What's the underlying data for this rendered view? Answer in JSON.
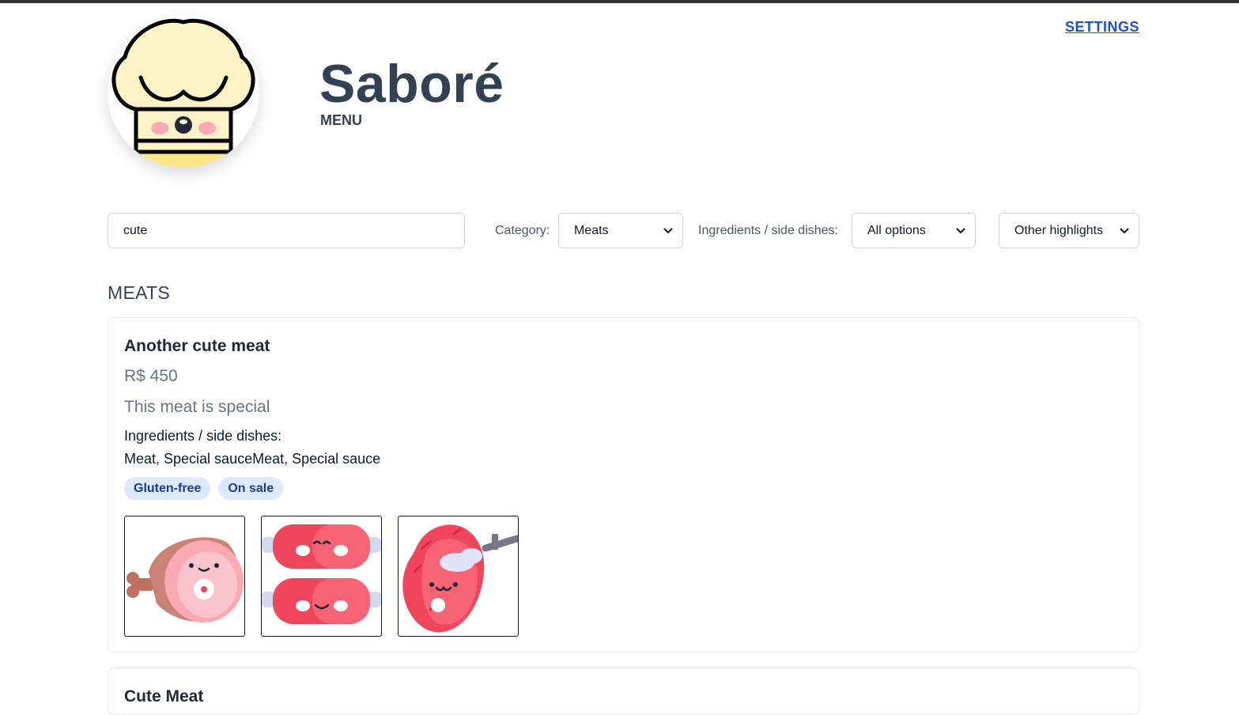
{
  "brand": {
    "title": "Saboré",
    "subtitle": "MENU",
    "logo_icon": "chef-hat-icon"
  },
  "header": {
    "settings_label": "SETTINGS"
  },
  "filters": {
    "search_value": "cute",
    "category_label": "Category:",
    "category_value": "Meats",
    "ingredients_label": "Ingredients / side dishes:",
    "ingredients_value": "All options",
    "highlights_value": "Other highlights"
  },
  "section": {
    "title": "MEATS"
  },
  "items": [
    {
      "name": "Another cute meat",
      "price": "R$ 450",
      "description": "This meat is special",
      "ingredients_label": "Ingredients / side dishes:",
      "ingredients": "Meat, Special sauceMeat, Special sauce",
      "tags": [
        "Gluten-free",
        "On sale"
      ],
      "images": [
        "ham-icon",
        "sausages-icon",
        "steak-icon"
      ]
    },
    {
      "name": "Cute Meat"
    }
  ],
  "colors": {
    "accent": "#1d4ed8",
    "heading": "#334155",
    "tag_bg": "#dbeafe",
    "tag_text": "#1e3a8a",
    "meat_red": "#f0455a"
  }
}
